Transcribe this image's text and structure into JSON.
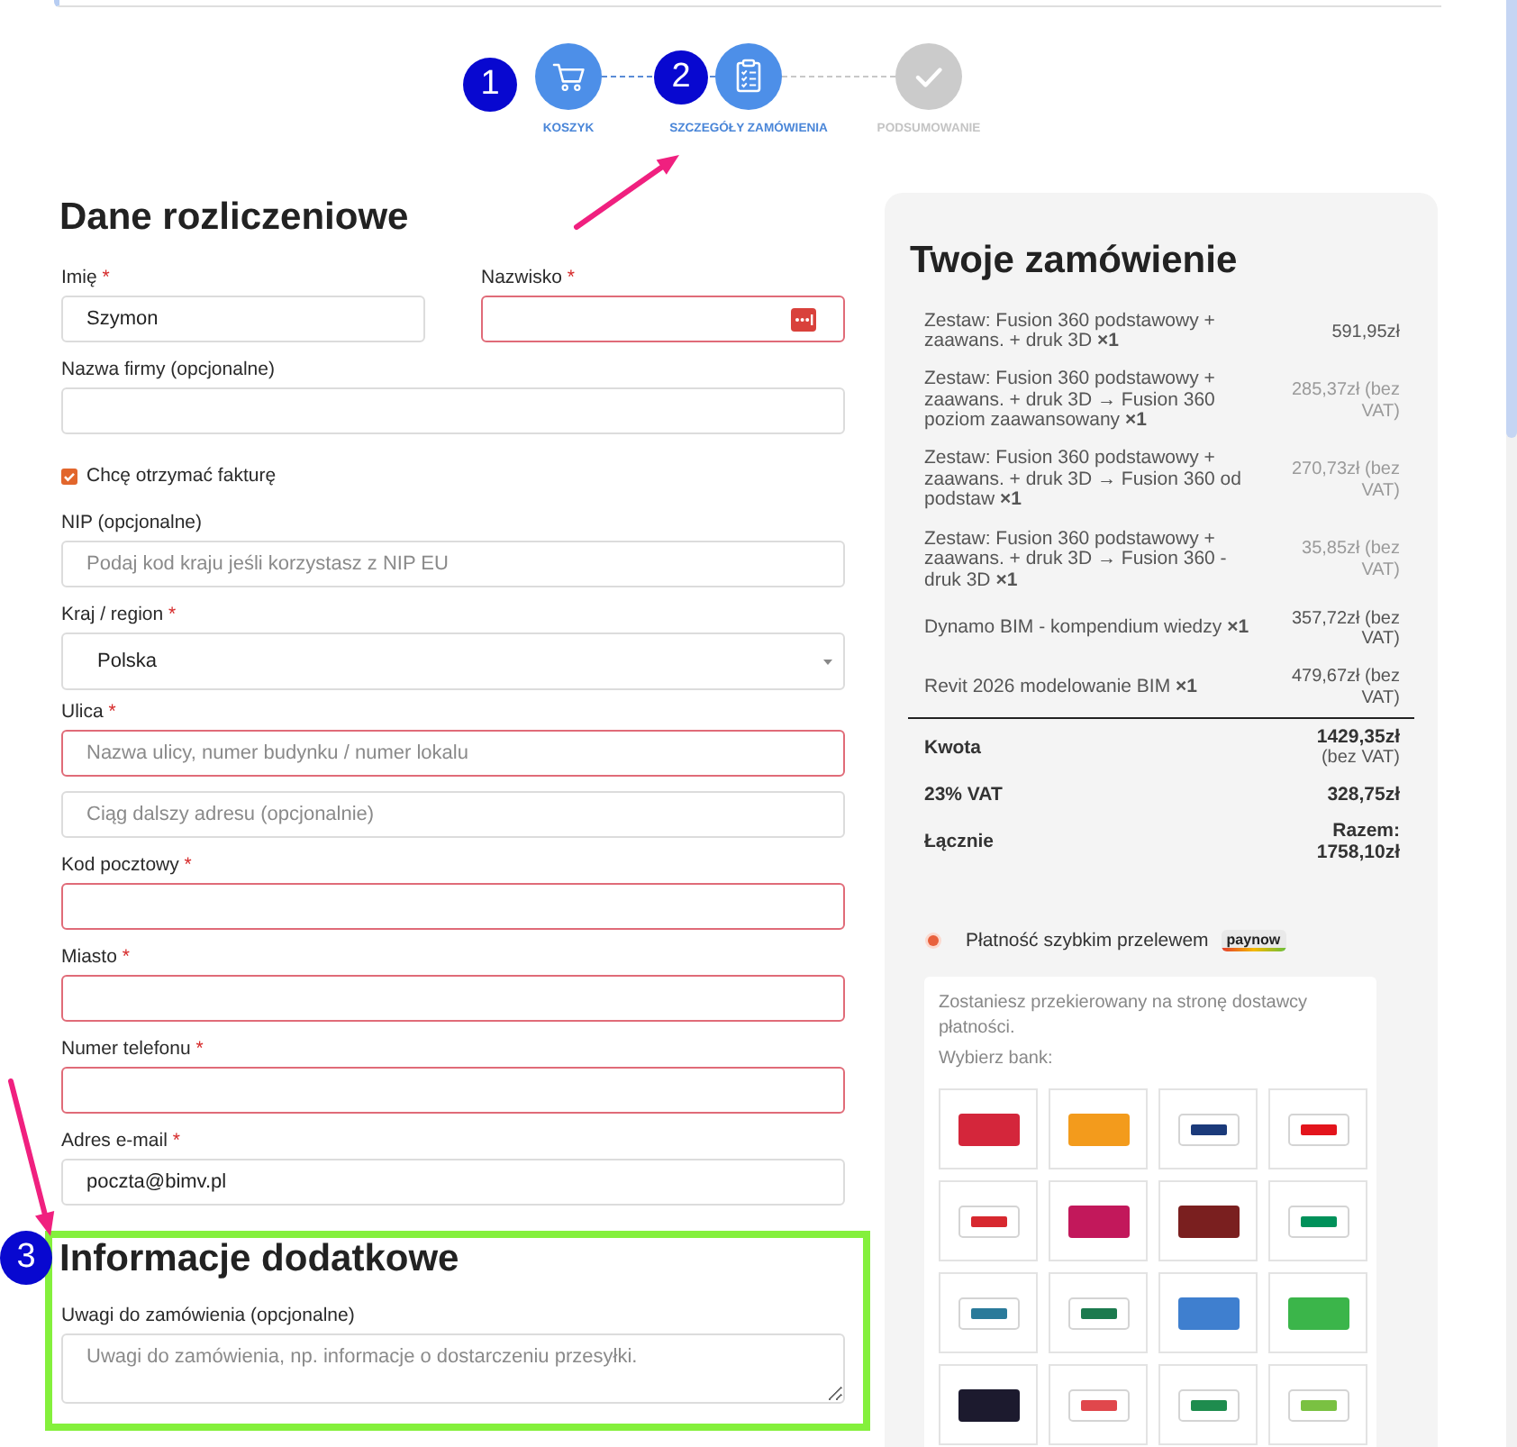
{
  "steps": [
    {
      "kind": "cart",
      "label": "KOSZYK",
      "active": true
    },
    {
      "kind": "clipboard",
      "label": "SZCZEGÓŁY ZAMÓWIENIA",
      "active": true
    },
    {
      "kind": "check",
      "label": "PODSUMOWANIE",
      "active": false
    }
  ],
  "callouts": [
    {
      "label": "1"
    },
    {
      "label": "2"
    },
    {
      "label": "3"
    }
  ],
  "billing": {
    "title": "Dane rozliczeniowe",
    "rows": [
      {
        "fields": [
          {
            "kind": "text",
            "label": "Imię",
            "required_mark": "*",
            "value": "Szymon",
            "invalid": false,
            "autofill": false
          },
          {
            "kind": "text",
            "label": "Nazwisko",
            "required_mark": "*",
            "invalid": true,
            "autofill": true
          }
        ]
      },
      {
        "fields": [
          {
            "kind": "text",
            "label": "Nazwa firmy (opcjonalne)",
            "invalid": false,
            "autofill": false
          }
        ]
      },
      {
        "fields": [
          {
            "kind": "checkbox",
            "label": "Chcę otrzymać fakturę",
            "checked": true
          }
        ]
      },
      {
        "fields": [
          {
            "kind": "text",
            "label": "NIP (opcjonalne)",
            "placeholder": "Podaj kod kraju jeśli korzystasz z NIP EU",
            "invalid": false,
            "autofill": false
          }
        ]
      },
      {
        "fields": [
          {
            "kind": "select",
            "label": "Kraj / region",
            "required_mark": "*",
            "value": "Polska"
          }
        ]
      },
      {
        "fields": [
          {
            "kind": "text",
            "label": "Ulica",
            "required_mark": "*",
            "placeholder": "Nazwa ulicy, numer budynku / numer lokalu",
            "invalid": true,
            "autofill": false
          }
        ]
      },
      {
        "fields": [
          {
            "kind": "text",
            "placeholder": "Ciąg dalszy adresu (opcjonalnie)",
            "invalid": false,
            "autofill": false
          }
        ]
      },
      {
        "fields": [
          {
            "kind": "text",
            "label": "Kod pocztowy",
            "required_mark": "*",
            "invalid": true,
            "autofill": false
          }
        ]
      },
      {
        "fields": [
          {
            "kind": "text",
            "label": "Miasto",
            "required_mark": "*",
            "invalid": true,
            "autofill": false
          }
        ]
      },
      {
        "fields": [
          {
            "kind": "text",
            "label": "Numer telefonu",
            "required_mark": "*",
            "invalid": true,
            "autofill": false
          }
        ]
      },
      {
        "fields": [
          {
            "kind": "text",
            "label": "Adres e-mail",
            "required_mark": "*",
            "value": "poczta@bimv.pl",
            "invalid": false,
            "autofill": false
          }
        ]
      }
    ]
  },
  "additional": {
    "title": "Informacje dodatkowe",
    "fields": [
      {
        "kind": "textarea",
        "label": "Uwagi do zamówienia (opcjonalne)",
        "placeholder": "Uwagi do zamówienia, np. informacje o dostarczeniu przesyłki."
      }
    ]
  },
  "order": {
    "title": "Twoje zamówienie",
    "items": [
      {
        "name": "Zestaw: Fusion 360 podstawowy + zaawans. + druk 3D **×1**",
        "price": "591,95zł",
        "muted": false
      },
      {
        "name": "Zestaw: Fusion 360 podstawowy + zaawans. + druk 3D → Fusion 360 poziom zaawansowany **×1**",
        "price": "285,37zł (bez VAT)",
        "muted": true
      },
      {
        "name": "Zestaw: Fusion 360 podstawowy + zaawans. + druk 3D → Fusion 360 od podstaw **×1**",
        "price": "270,73zł (bez VAT)",
        "muted": true
      },
      {
        "name": "Zestaw: Fusion 360 podstawowy + zaawans. + druk 3D → Fusion 360 - druk 3D **×1**",
        "price": "35,85zł (bez VAT)",
        "muted": true
      },
      {
        "name": "Dynamo BIM - kompendium wiedzy **×1**",
        "price": "357,72zł (bez VAT)",
        "muted": false
      },
      {
        "name": "Revit 2026 modelowanie BIM **×1**",
        "price": "479,67zł (bez VAT)",
        "muted": false
      }
    ],
    "totals": [
      {
        "label": "Kwota",
        "value": "1429,35zł",
        "note": "(bez VAT)"
      },
      {
        "label": "23% VAT",
        "value": "328,75zł"
      },
      {
        "label": "Łącznie",
        "value": "Razem: 1758,10zł"
      }
    ]
  },
  "payment": {
    "methods": [
      {
        "label": "Płatność szybkim przelewem",
        "badge": "paynow",
        "selected": true
      }
    ],
    "notice": "Zostaniesz przekierowany na stronę dostawcy płatności.",
    "bank_prompt": "Wybierz bank:",
    "banks": [
      {
        "kind": "solid",
        "color": "#d4263b"
      },
      {
        "kind": "solid",
        "color": "#f39b1c"
      },
      {
        "kind": "outline",
        "color": "#1b3a7a"
      },
      {
        "kind": "outline",
        "color": "#e3141c"
      },
      {
        "kind": "outline",
        "color": "#d7282f"
      },
      {
        "kind": "solid",
        "color": "#c2185b"
      },
      {
        "kind": "solid",
        "color": "#7a1f1f"
      },
      {
        "kind": "outline",
        "color": "#00915a"
      },
      {
        "kind": "outline",
        "color": "#2a7a9a"
      },
      {
        "kind": "outline",
        "color": "#1b7a4e"
      },
      {
        "kind": "solid",
        "color": "#3f7fcf"
      },
      {
        "kind": "solid",
        "color": "#3bb54a"
      },
      {
        "kind": "solid",
        "color": "#1c1a2e"
      },
      {
        "kind": "outline",
        "color": "#e0474c"
      },
      {
        "kind": "outline",
        "color": "#1e8c4e"
      },
      {
        "kind": "outline",
        "color": "#7ac142"
      }
    ]
  }
}
